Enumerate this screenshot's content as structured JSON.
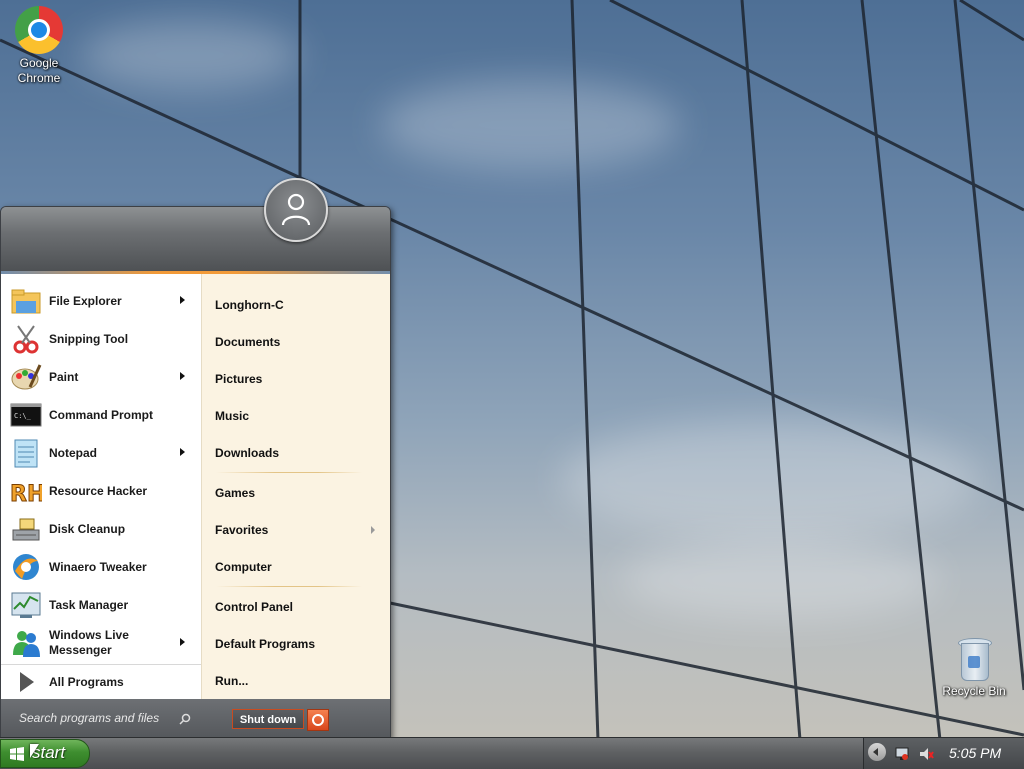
{
  "desktop": {
    "icons": [
      {
        "label_line1": "Google",
        "label_line2": "Chrome",
        "icon": "chrome-icon"
      },
      {
        "label": "Recycle Bin",
        "icon": "recycle-bin-icon"
      }
    ]
  },
  "start_menu": {
    "user_icon": "user-avatar-icon",
    "left_items": [
      {
        "label": "File Explorer",
        "icon": "file-explorer-icon",
        "has_submenu": true
      },
      {
        "label": "Snipping Tool",
        "icon": "snipping-tool-icon",
        "has_submenu": false
      },
      {
        "label": "Paint",
        "icon": "paint-icon",
        "has_submenu": true
      },
      {
        "label": "Command Prompt",
        "icon": "command-prompt-icon",
        "has_submenu": false
      },
      {
        "label": "Notepad",
        "icon": "notepad-icon",
        "has_submenu": true
      },
      {
        "label": "Resource Hacker",
        "icon": "resource-hacker-icon",
        "has_submenu": false
      },
      {
        "label": "Disk Cleanup",
        "icon": "disk-cleanup-icon",
        "has_submenu": false
      },
      {
        "label": "Winaero Tweaker",
        "icon": "winaero-tweaker-icon",
        "has_submenu": false
      },
      {
        "label": "Task Manager",
        "icon": "task-manager-icon",
        "has_submenu": false
      },
      {
        "label_line1": "Windows Live",
        "label_line2": "Messenger",
        "icon": "messenger-icon",
        "has_submenu": true
      }
    ],
    "all_programs": "All Programs",
    "right_items": [
      {
        "label": "Longhorn-C"
      },
      {
        "label": "Documents"
      },
      {
        "label": "Pictures"
      },
      {
        "label": "Music"
      },
      {
        "label": "Downloads"
      },
      {
        "label": "Games"
      },
      {
        "label": "Favorites",
        "has_submenu": true
      },
      {
        "label": "Computer"
      },
      {
        "label": "Control Panel"
      },
      {
        "label": "Default Programs"
      },
      {
        "label": "Run..."
      }
    ],
    "search_placeholder": "Search programs and files",
    "shutdown_label": "Shut down",
    "colors": {
      "accent_orange": "#f29a38",
      "right_panel_bg": "#fbf3e2",
      "shutdown_border": "#c94b1f"
    }
  },
  "taskbar": {
    "start_label": "start",
    "start_color": "#3e8e2f",
    "clock": "5:05 PM",
    "tray_icons": [
      "show-hidden-icons-arrow",
      "network-icon",
      "volume-muted-icon"
    ]
  }
}
